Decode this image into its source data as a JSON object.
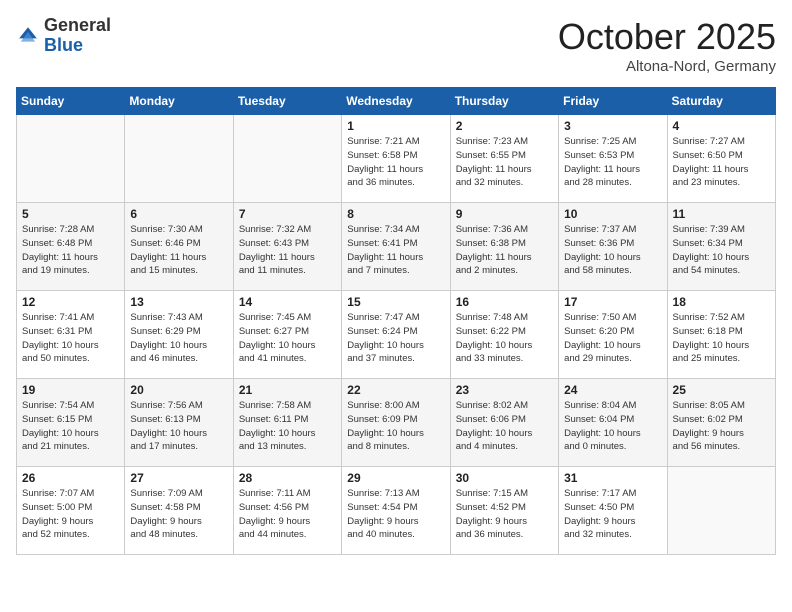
{
  "header": {
    "logo_general": "General",
    "logo_blue": "Blue",
    "month": "October 2025",
    "location": "Altona-Nord, Germany"
  },
  "weekdays": [
    "Sunday",
    "Monday",
    "Tuesday",
    "Wednesday",
    "Thursday",
    "Friday",
    "Saturday"
  ],
  "weeks": [
    [
      {
        "day": "",
        "detail": ""
      },
      {
        "day": "",
        "detail": ""
      },
      {
        "day": "",
        "detail": ""
      },
      {
        "day": "1",
        "detail": "Sunrise: 7:21 AM\nSunset: 6:58 PM\nDaylight: 11 hours\nand 36 minutes."
      },
      {
        "day": "2",
        "detail": "Sunrise: 7:23 AM\nSunset: 6:55 PM\nDaylight: 11 hours\nand 32 minutes."
      },
      {
        "day": "3",
        "detail": "Sunrise: 7:25 AM\nSunset: 6:53 PM\nDaylight: 11 hours\nand 28 minutes."
      },
      {
        "day": "4",
        "detail": "Sunrise: 7:27 AM\nSunset: 6:50 PM\nDaylight: 11 hours\nand 23 minutes."
      }
    ],
    [
      {
        "day": "5",
        "detail": "Sunrise: 7:28 AM\nSunset: 6:48 PM\nDaylight: 11 hours\nand 19 minutes."
      },
      {
        "day": "6",
        "detail": "Sunrise: 7:30 AM\nSunset: 6:46 PM\nDaylight: 11 hours\nand 15 minutes."
      },
      {
        "day": "7",
        "detail": "Sunrise: 7:32 AM\nSunset: 6:43 PM\nDaylight: 11 hours\nand 11 minutes."
      },
      {
        "day": "8",
        "detail": "Sunrise: 7:34 AM\nSunset: 6:41 PM\nDaylight: 11 hours\nand 7 minutes."
      },
      {
        "day": "9",
        "detail": "Sunrise: 7:36 AM\nSunset: 6:38 PM\nDaylight: 11 hours\nand 2 minutes."
      },
      {
        "day": "10",
        "detail": "Sunrise: 7:37 AM\nSunset: 6:36 PM\nDaylight: 10 hours\nand 58 minutes."
      },
      {
        "day": "11",
        "detail": "Sunrise: 7:39 AM\nSunset: 6:34 PM\nDaylight: 10 hours\nand 54 minutes."
      }
    ],
    [
      {
        "day": "12",
        "detail": "Sunrise: 7:41 AM\nSunset: 6:31 PM\nDaylight: 10 hours\nand 50 minutes."
      },
      {
        "day": "13",
        "detail": "Sunrise: 7:43 AM\nSunset: 6:29 PM\nDaylight: 10 hours\nand 46 minutes."
      },
      {
        "day": "14",
        "detail": "Sunrise: 7:45 AM\nSunset: 6:27 PM\nDaylight: 10 hours\nand 41 minutes."
      },
      {
        "day": "15",
        "detail": "Sunrise: 7:47 AM\nSunset: 6:24 PM\nDaylight: 10 hours\nand 37 minutes."
      },
      {
        "day": "16",
        "detail": "Sunrise: 7:48 AM\nSunset: 6:22 PM\nDaylight: 10 hours\nand 33 minutes."
      },
      {
        "day": "17",
        "detail": "Sunrise: 7:50 AM\nSunset: 6:20 PM\nDaylight: 10 hours\nand 29 minutes."
      },
      {
        "day": "18",
        "detail": "Sunrise: 7:52 AM\nSunset: 6:18 PM\nDaylight: 10 hours\nand 25 minutes."
      }
    ],
    [
      {
        "day": "19",
        "detail": "Sunrise: 7:54 AM\nSunset: 6:15 PM\nDaylight: 10 hours\nand 21 minutes."
      },
      {
        "day": "20",
        "detail": "Sunrise: 7:56 AM\nSunset: 6:13 PM\nDaylight: 10 hours\nand 17 minutes."
      },
      {
        "day": "21",
        "detail": "Sunrise: 7:58 AM\nSunset: 6:11 PM\nDaylight: 10 hours\nand 13 minutes."
      },
      {
        "day": "22",
        "detail": "Sunrise: 8:00 AM\nSunset: 6:09 PM\nDaylight: 10 hours\nand 8 minutes."
      },
      {
        "day": "23",
        "detail": "Sunrise: 8:02 AM\nSunset: 6:06 PM\nDaylight: 10 hours\nand 4 minutes."
      },
      {
        "day": "24",
        "detail": "Sunrise: 8:04 AM\nSunset: 6:04 PM\nDaylight: 10 hours\nand 0 minutes."
      },
      {
        "day": "25",
        "detail": "Sunrise: 8:05 AM\nSunset: 6:02 PM\nDaylight: 9 hours\nand 56 minutes."
      }
    ],
    [
      {
        "day": "26",
        "detail": "Sunrise: 7:07 AM\nSunset: 5:00 PM\nDaylight: 9 hours\nand 52 minutes."
      },
      {
        "day": "27",
        "detail": "Sunrise: 7:09 AM\nSunset: 4:58 PM\nDaylight: 9 hours\nand 48 minutes."
      },
      {
        "day": "28",
        "detail": "Sunrise: 7:11 AM\nSunset: 4:56 PM\nDaylight: 9 hours\nand 44 minutes."
      },
      {
        "day": "29",
        "detail": "Sunrise: 7:13 AM\nSunset: 4:54 PM\nDaylight: 9 hours\nand 40 minutes."
      },
      {
        "day": "30",
        "detail": "Sunrise: 7:15 AM\nSunset: 4:52 PM\nDaylight: 9 hours\nand 36 minutes."
      },
      {
        "day": "31",
        "detail": "Sunrise: 7:17 AM\nSunset: 4:50 PM\nDaylight: 9 hours\nand 32 minutes."
      },
      {
        "day": "",
        "detail": ""
      }
    ]
  ]
}
